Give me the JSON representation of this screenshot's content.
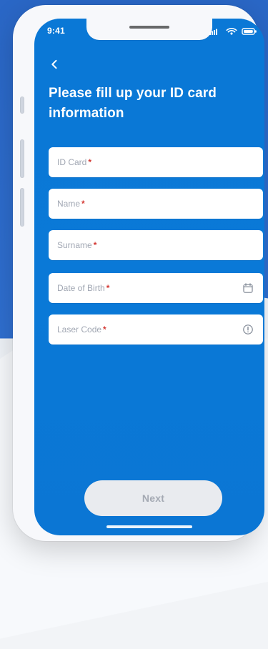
{
  "status_bar": {
    "time": "9:41",
    "icons": [
      "signal-icon",
      "wifi-icon",
      "battery-icon"
    ]
  },
  "navigation": {
    "back_icon": "chevron-left-icon"
  },
  "page": {
    "title": "Please fill up your ID card information"
  },
  "form": {
    "required_mark": "*",
    "fields": [
      {
        "label": "ID Card",
        "icon": ""
      },
      {
        "label": "Name",
        "icon": ""
      },
      {
        "label": "Surname",
        "icon": ""
      },
      {
        "label": "Date of Birth",
        "icon": "calendar-icon"
      },
      {
        "label": "Laser Code",
        "icon": "info-icon"
      }
    ]
  },
  "actions": {
    "next_label": "Next"
  },
  "colors": {
    "screen_blue": "#0a78d6",
    "required_red": "#d43a35",
    "button_disabled_bg": "#e9ebef",
    "button_disabled_text": "#a4a9b3"
  }
}
